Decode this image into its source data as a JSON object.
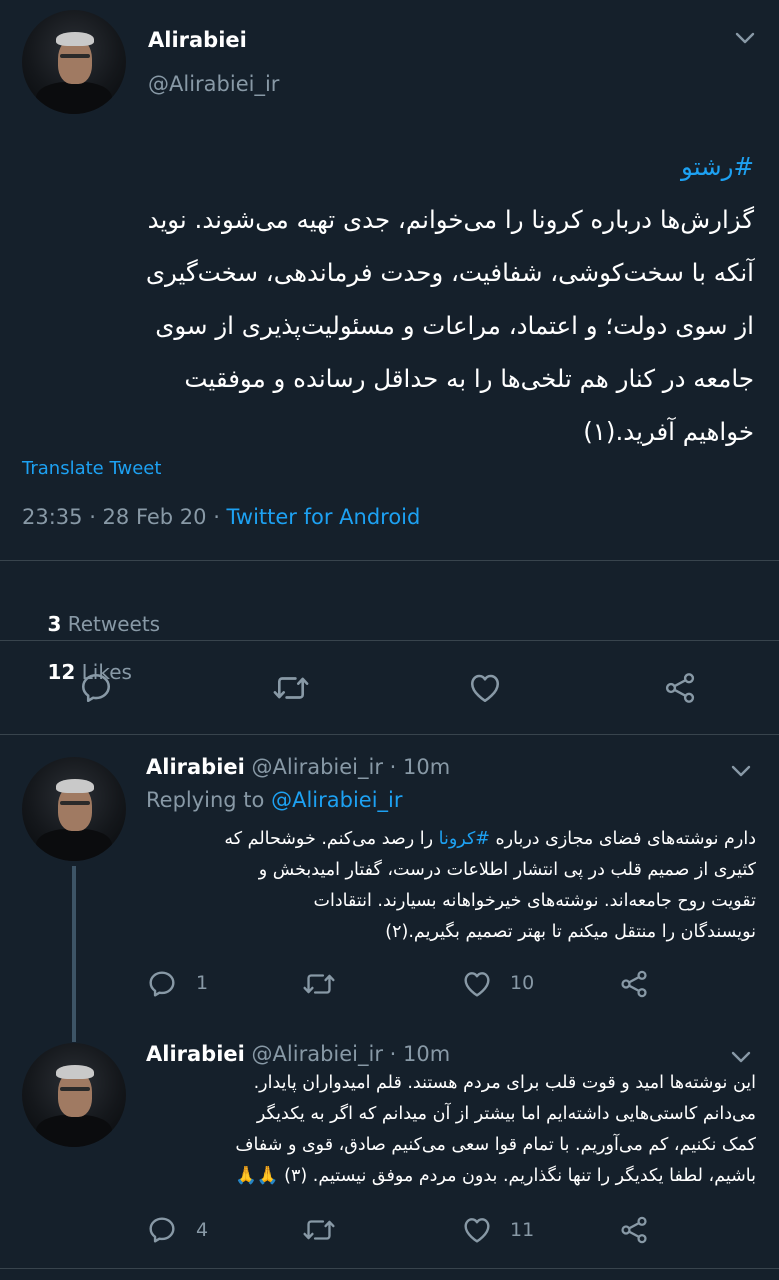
{
  "main_tweet": {
    "display_name": "Alirabiei",
    "handle": "@Alirabiei_ir",
    "hashtag": "#رشتو",
    "lines": [
      "گزارش‌ها درباره کرونا را می‌خوانم، جدی تهیه می‌شوند. نوید",
      "آنکه با سخت‌کوشی، شفافیت، وحدت فرماندهی، سخت‌گیری",
      "از سوی دولت؛ و اعتماد، مراعات و مسئولیت‌پذیری از سوی",
      "جامعه در کنار هم تلخی‌ها را به حداقل رسانده و موفقیت",
      "خواهیم آفرید.(۱)"
    ],
    "translate_label": "Translate Tweet",
    "timestamp": "23:35 · 28 Feb 20 · ",
    "source": "Twitter for Android",
    "retweets_count": "3",
    "retweets_label": "Retweets",
    "likes_count": "12",
    "likes_label": "Likes"
  },
  "replies": [
    {
      "display_name": "Alirabiei",
      "handle": "@Alirabiei_ir",
      "time": "· 10m",
      "replying_to_label": "Replying to",
      "replying_to_handle": "@Alirabiei_ir",
      "line1_pre": "دارم نوشته‌های فضای مجازی درباره ",
      "line1_tag": "#کرونا",
      "line1_post": " را رصد می‌کنم. خوشحالم که",
      "lines": [
        "کثیری از صمیم قلب در پی انتشار اطلاعات درست، گفتار امیدبخش و",
        "تقویت روح جامعه‌اند. نوشته‌های خیرخواهانه بسیارند. انتقادات",
        "نویسندگان را منتقل میکنم تا بهتر تصمیم بگیریم.(۲)"
      ],
      "reply_count": "1",
      "retweet_count": "",
      "like_count": "10"
    },
    {
      "display_name": "Alirabiei",
      "handle": "@Alirabiei_ir",
      "time": "· 10m",
      "lines": [
        "این نوشته‌ها امید و قوت قلب برای مردم هستند. قلم امیدواران پایدار.",
        "می‌دانم کاستی‌هایی داشته‌ایم اما بیشتر از آن میدانم که اگر به یکدیگر",
        "کمک نکنیم، کم می‌آوریم. با تمام قوا سعی می‌کنیم صادق، قوی و شفاف",
        "باشیم، لطفا یکدیگر را تنها نگذاریم. بدون مردم موفق نیستیم. (۳) 🙏🙏"
      ],
      "reply_count": "4",
      "retweet_count": "",
      "like_count": "11"
    }
  ],
  "colors": {
    "background": "#15202b",
    "secondary_text": "#8899a6",
    "accent": "#1da1f2",
    "divider": "#38444d"
  }
}
